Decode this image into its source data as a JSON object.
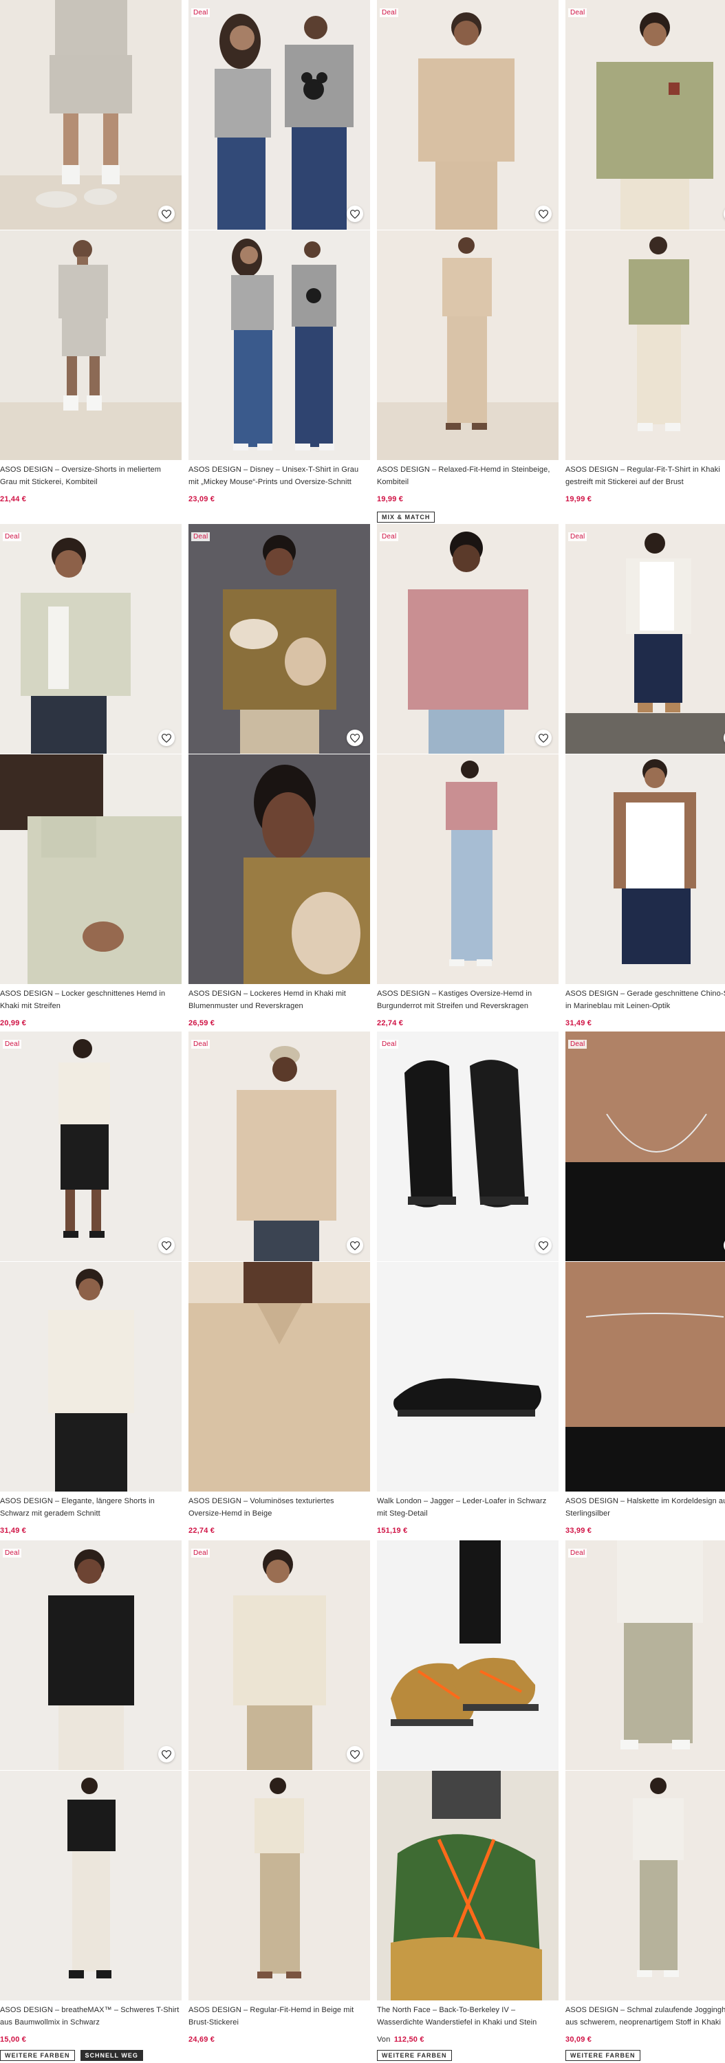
{
  "deal_label": "Deal",
  "products": [
    {
      "title": "ASOS DESIGN – Oversize-Shorts in meliertem Grau mit Stickerei, Kombiteil",
      "price": "21,44 €",
      "deal": true,
      "tags": []
    },
    {
      "title": "ASOS DESIGN – Disney – Unisex-T-Shirt in Grau mit „Mickey Mouse“-Prints und Oversize-Schnitt",
      "price": "23,09 €",
      "deal": true,
      "tags": []
    },
    {
      "title": "ASOS DESIGN – Relaxed-Fit-Hemd in Steinbeige, Kombiteil",
      "price": "19,99 €",
      "deal": true,
      "tags": [
        "MIX & MATCH"
      ]
    },
    {
      "title": "ASOS DESIGN – Regular-Fit-T-Shirt in Khaki gestreift mit Stickerei auf der Brust",
      "price": "19,99 €",
      "deal": true,
      "tags": []
    },
    {
      "title": "ASOS DESIGN – Locker geschnittenes Hemd in Khaki mit Streifen",
      "price": "20,99 €",
      "deal": true,
      "tags": []
    },
    {
      "title": "ASOS DESIGN – Lockeres Hemd in Khaki mit Blumenmuster und Reverskragen",
      "price": "26,59 €",
      "deal": true,
      "tags": []
    },
    {
      "title": "ASOS DESIGN – Kastiges Oversize-Hemd in Burgunderrot mit Streifen und Reverskragen",
      "price": "22,74 €",
      "deal": true,
      "tags": []
    },
    {
      "title": "ASOS DESIGN – Gerade geschnittene Chino-Shorts in Marineblau mit Leinen-Optik",
      "price": "31,49 €",
      "deal": true,
      "tags": []
    },
    {
      "title": "ASOS DESIGN – Elegante, längere Shorts in Schwarz mit geradem Schnitt",
      "price": "31,49 €",
      "deal": true,
      "tags": []
    },
    {
      "title": "ASOS DESIGN – Voluminöses texturiertes Oversize-Hemd in Beige",
      "price": "22,74 €",
      "deal": true,
      "tags": []
    },
    {
      "title": "Walk London – Jagger – Leder-Loafer in Schwarz mit Steg-Detail",
      "price": "151,19 €",
      "deal": true,
      "tags": []
    },
    {
      "title": "ASOS DESIGN – Halskette im Kordeldesign aus Sterlingsilber",
      "price": "33,99 €",
      "deal": true,
      "tags": []
    },
    {
      "title": "ASOS DESIGN – breatheMAX™ – Schweres T-Shirt aus Baumwollmix in Schwarz",
      "price": "15,00 €",
      "deal": true,
      "tags": [
        "WEITERE FARBEN",
        "SCHNELL WEG"
      ]
    },
    {
      "title": "ASOS DESIGN – Regular-Fit-Hemd in Beige mit Brust-Stickerei",
      "price": "24,69 €",
      "deal": true,
      "tags": []
    },
    {
      "title": "The North Face – Back-To-Berkeley IV – Wasserdichte Wanderstiefel in Khaki und Stein",
      "price_from": "Von",
      "price": "112,50 €",
      "deal": false,
      "tags": [
        "WEITERE FARBEN"
      ]
    },
    {
      "title": "ASOS DESIGN – Schmal zulaufende Jogginghose aus schwerem, neoprenartigem Stoff in Khaki",
      "price": "30,09 €",
      "deal": true,
      "tags": [
        "WEITERE FARBEN"
      ]
    }
  ],
  "colors": {
    "price": "#d01345",
    "text": "#2d2d2d",
    "deal": "#d01345"
  },
  "icons": {
    "favourite": "heart-outline-icon"
  }
}
